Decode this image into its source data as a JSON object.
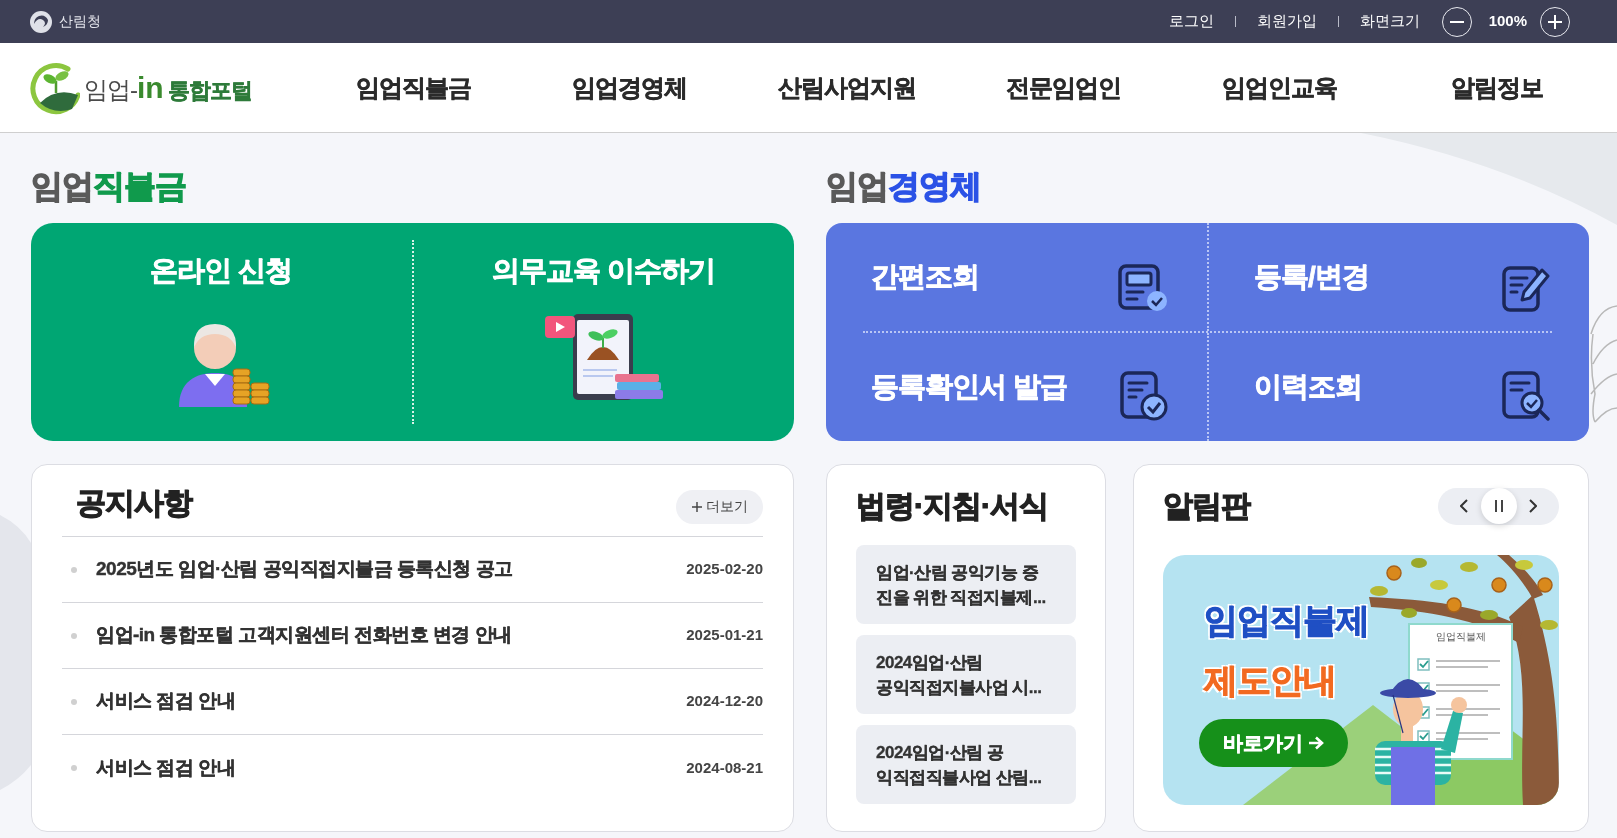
{
  "top_bar": {
    "agency": "산림청",
    "links": [
      "로그인",
      "회원가입",
      "화면크기"
    ],
    "zoom": "100%"
  },
  "nav": {
    "logo": {
      "prefix": "임업-",
      "brand": "in",
      "suffix": "통합포털"
    },
    "items": [
      "임업직불금",
      "임업경영체",
      "산림사업지원",
      "전문임업인",
      "임업인교육",
      "알림정보"
    ]
  },
  "direct_payment": {
    "title": {
      "plain": "임업",
      "accent": "직불금"
    },
    "actions": [
      {
        "label": "온라인 신청",
        "kind": "apply"
      },
      {
        "label": "의무교육 이수하기",
        "kind": "education"
      }
    ]
  },
  "management_entity": {
    "title": {
      "plain": "임업",
      "accent": "경영체"
    },
    "actions": [
      {
        "label": "간편조회",
        "kind": "lookup"
      },
      {
        "label": "등록/변경",
        "kind": "edit"
      },
      {
        "label": "등록확인서 발급",
        "kind": "certificate"
      },
      {
        "label": "이력조회",
        "kind": "history"
      }
    ]
  },
  "notices": {
    "title": "공지사항",
    "more": "더보기",
    "rows": [
      {
        "title": "2025년도 임업·산림 공익직접지불금 등록신청 공고",
        "date": "2025-02-20"
      },
      {
        "title": "임업-in 통합포털 고객지원센터 전화번호 변경 안내",
        "date": "2025-01-21"
      },
      {
        "title": "서비스 점검 안내",
        "date": "2024-12-20"
      },
      {
        "title": "서비스 점검 안내",
        "date": "2024-08-21"
      }
    ]
  },
  "regulations": {
    "title": "법령·지침·서식",
    "items": [
      {
        "lines": [
          "임업·산림 공익기능 증",
          "진을 위한 직접지불제..."
        ]
      },
      {
        "lines": [
          "2024임업·산림",
          "공익직접지불사업 시..."
        ]
      },
      {
        "lines": [
          "2024임업·산림 공",
          "익직접직불사업 산림..."
        ]
      }
    ]
  },
  "board": {
    "title": "알림판",
    "banner": {
      "headline": "임업직불제",
      "subline": "제도안내",
      "button": "바로가기",
      "document_title": "임업직불제"
    }
  }
}
